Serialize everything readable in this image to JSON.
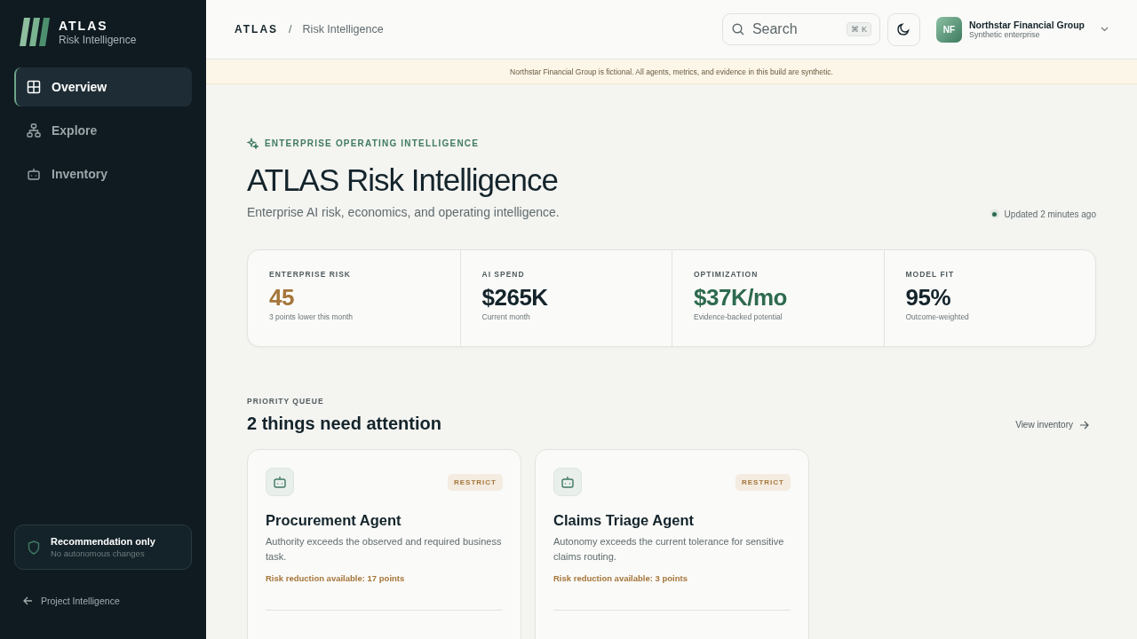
{
  "sidebar": {
    "brand": "ATLAS",
    "tagline": "Risk Intelligence",
    "nav": [
      {
        "label": "Overview",
        "selected": true
      },
      {
        "label": "Explore",
        "selected": false
      },
      {
        "label": "Inventory",
        "selected": false
      }
    ],
    "notice": {
      "title": "Recommendation only",
      "subtitle": "No autonomous changes"
    },
    "back_link": "Project Intelligence"
  },
  "topbar": {
    "breadcrumb": {
      "root": "ATLAS",
      "separator": "/",
      "current": "Risk Intelligence"
    },
    "search": {
      "placeholder": "Search",
      "shortcut": "⌘ K"
    },
    "org": {
      "initials": "NF",
      "name": "Northstar Financial Group",
      "subtitle": "Synthetic enterprise"
    }
  },
  "banner": "Northstar Financial Group is fictional. All agents, metrics, and evidence in this build are synthetic.",
  "hero": {
    "eyebrow": "ENTERPRISE OPERATING INTELLIGENCE",
    "title": "ATLAS Risk Intelligence",
    "subtitle": "Enterprise AI risk, economics, and operating intelligence.",
    "updated": "Updated 2 minutes ago"
  },
  "metrics": [
    {
      "label": "ENTERPRISE RISK",
      "value": "45",
      "note": "3 points lower this month",
      "color": "#a57539"
    },
    {
      "label": "AI SPEND",
      "value": "$265K",
      "note": "Current month",
      "color": "#14242b"
    },
    {
      "label": "OPTIMIZATION",
      "value": "$37K/mo",
      "note": "Evidence-backed potential",
      "color": "#2e6a4e"
    },
    {
      "label": "MODEL FIT",
      "value": "95%",
      "note": "Outcome-weighted",
      "color": "#14242b"
    }
  ],
  "queue": {
    "eyebrow": "PRIORITY QUEUE",
    "title": "2 things need attention",
    "link": "View inventory",
    "cards": [
      {
        "badge": "RESTRICT",
        "name": "Procurement Agent",
        "description": "Authority exceeds the observed and required business task.",
        "reduction": "Risk reduction available: 17 points"
      },
      {
        "badge": "RESTRICT",
        "name": "Claims Triage Agent",
        "description": "Autonomy exceeds the current tolerance for sensitive claims routing.",
        "reduction": "Risk reduction available: 3 points"
      }
    ]
  }
}
